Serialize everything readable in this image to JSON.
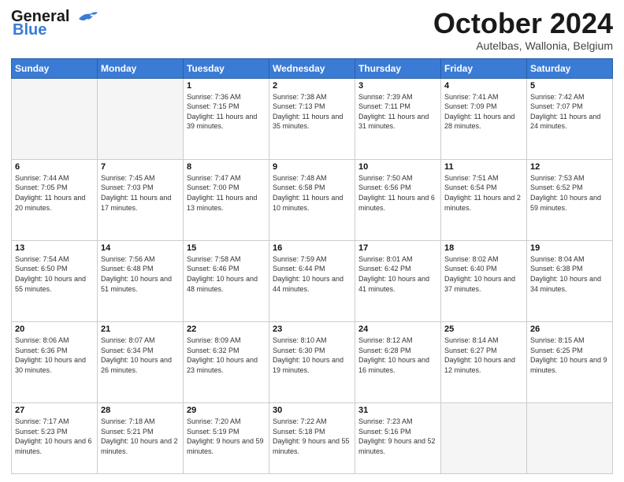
{
  "header": {
    "logo_line1": "General",
    "logo_line2": "Blue",
    "month": "October 2024",
    "location": "Autelbas, Wallonia, Belgium"
  },
  "days_of_week": [
    "Sunday",
    "Monday",
    "Tuesday",
    "Wednesday",
    "Thursday",
    "Friday",
    "Saturday"
  ],
  "weeks": [
    [
      {
        "day": "",
        "info": ""
      },
      {
        "day": "",
        "info": ""
      },
      {
        "day": "1",
        "info": "Sunrise: 7:36 AM\nSunset: 7:15 PM\nDaylight: 11 hours and 39 minutes."
      },
      {
        "day": "2",
        "info": "Sunrise: 7:38 AM\nSunset: 7:13 PM\nDaylight: 11 hours and 35 minutes."
      },
      {
        "day": "3",
        "info": "Sunrise: 7:39 AM\nSunset: 7:11 PM\nDaylight: 11 hours and 31 minutes."
      },
      {
        "day": "4",
        "info": "Sunrise: 7:41 AM\nSunset: 7:09 PM\nDaylight: 11 hours and 28 minutes."
      },
      {
        "day": "5",
        "info": "Sunrise: 7:42 AM\nSunset: 7:07 PM\nDaylight: 11 hours and 24 minutes."
      }
    ],
    [
      {
        "day": "6",
        "info": "Sunrise: 7:44 AM\nSunset: 7:05 PM\nDaylight: 11 hours and 20 minutes."
      },
      {
        "day": "7",
        "info": "Sunrise: 7:45 AM\nSunset: 7:03 PM\nDaylight: 11 hours and 17 minutes."
      },
      {
        "day": "8",
        "info": "Sunrise: 7:47 AM\nSunset: 7:00 PM\nDaylight: 11 hours and 13 minutes."
      },
      {
        "day": "9",
        "info": "Sunrise: 7:48 AM\nSunset: 6:58 PM\nDaylight: 11 hours and 10 minutes."
      },
      {
        "day": "10",
        "info": "Sunrise: 7:50 AM\nSunset: 6:56 PM\nDaylight: 11 hours and 6 minutes."
      },
      {
        "day": "11",
        "info": "Sunrise: 7:51 AM\nSunset: 6:54 PM\nDaylight: 11 hours and 2 minutes."
      },
      {
        "day": "12",
        "info": "Sunrise: 7:53 AM\nSunset: 6:52 PM\nDaylight: 10 hours and 59 minutes."
      }
    ],
    [
      {
        "day": "13",
        "info": "Sunrise: 7:54 AM\nSunset: 6:50 PM\nDaylight: 10 hours and 55 minutes."
      },
      {
        "day": "14",
        "info": "Sunrise: 7:56 AM\nSunset: 6:48 PM\nDaylight: 10 hours and 51 minutes."
      },
      {
        "day": "15",
        "info": "Sunrise: 7:58 AM\nSunset: 6:46 PM\nDaylight: 10 hours and 48 minutes."
      },
      {
        "day": "16",
        "info": "Sunrise: 7:59 AM\nSunset: 6:44 PM\nDaylight: 10 hours and 44 minutes."
      },
      {
        "day": "17",
        "info": "Sunrise: 8:01 AM\nSunset: 6:42 PM\nDaylight: 10 hours and 41 minutes."
      },
      {
        "day": "18",
        "info": "Sunrise: 8:02 AM\nSunset: 6:40 PM\nDaylight: 10 hours and 37 minutes."
      },
      {
        "day": "19",
        "info": "Sunrise: 8:04 AM\nSunset: 6:38 PM\nDaylight: 10 hours and 34 minutes."
      }
    ],
    [
      {
        "day": "20",
        "info": "Sunrise: 8:06 AM\nSunset: 6:36 PM\nDaylight: 10 hours and 30 minutes."
      },
      {
        "day": "21",
        "info": "Sunrise: 8:07 AM\nSunset: 6:34 PM\nDaylight: 10 hours and 26 minutes."
      },
      {
        "day": "22",
        "info": "Sunrise: 8:09 AM\nSunset: 6:32 PM\nDaylight: 10 hours and 23 minutes."
      },
      {
        "day": "23",
        "info": "Sunrise: 8:10 AM\nSunset: 6:30 PM\nDaylight: 10 hours and 19 minutes."
      },
      {
        "day": "24",
        "info": "Sunrise: 8:12 AM\nSunset: 6:28 PM\nDaylight: 10 hours and 16 minutes."
      },
      {
        "day": "25",
        "info": "Sunrise: 8:14 AM\nSunset: 6:27 PM\nDaylight: 10 hours and 12 minutes."
      },
      {
        "day": "26",
        "info": "Sunrise: 8:15 AM\nSunset: 6:25 PM\nDaylight: 10 hours and 9 minutes."
      }
    ],
    [
      {
        "day": "27",
        "info": "Sunrise: 7:17 AM\nSunset: 5:23 PM\nDaylight: 10 hours and 6 minutes."
      },
      {
        "day": "28",
        "info": "Sunrise: 7:18 AM\nSunset: 5:21 PM\nDaylight: 10 hours and 2 minutes."
      },
      {
        "day": "29",
        "info": "Sunrise: 7:20 AM\nSunset: 5:19 PM\nDaylight: 9 hours and 59 minutes."
      },
      {
        "day": "30",
        "info": "Sunrise: 7:22 AM\nSunset: 5:18 PM\nDaylight: 9 hours and 55 minutes."
      },
      {
        "day": "31",
        "info": "Sunrise: 7:23 AM\nSunset: 5:16 PM\nDaylight: 9 hours and 52 minutes."
      },
      {
        "day": "",
        "info": ""
      },
      {
        "day": "",
        "info": ""
      }
    ]
  ]
}
